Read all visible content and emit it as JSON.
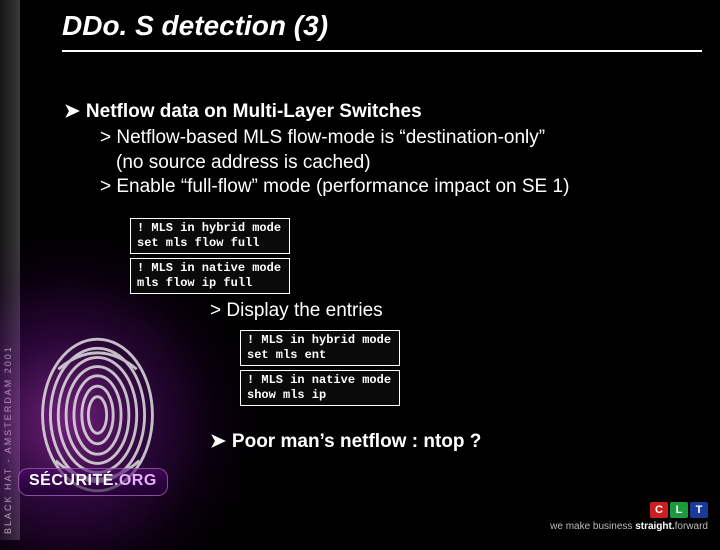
{
  "sidebar_text": "BLACK HAT - AMSTERDAM 2001",
  "title": "DDo. S detection (3)",
  "bullet1": "Netflow data on Multi-Layer Switches",
  "sub1a": "Netflow-based MLS flow-mode is “destination-only”",
  "sub1a_cont": "(no source address is cached)",
  "sub1b": "Enable “full-flow” mode (performance impact on SE 1)",
  "code1": "! MLS in hybrid mode\nset mls flow full",
  "code2": "! MLS in native mode\nmls flow ip full",
  "sub1c": "Display the entries",
  "code3": "! MLS in hybrid mode\nset mls ent",
  "code4": "! MLS in native mode\nshow mls ip",
  "bullet2": "Poor man’s netflow : ntop ?",
  "logo_main": "SÉCURITÉ",
  "logo_suffix": ".ORG",
  "footer_blocks": [
    "C",
    "L",
    "T"
  ],
  "footer_tag_plain1": "we make business ",
  "footer_tag_bold": "straight.",
  "footer_tag_plain2": "forward"
}
